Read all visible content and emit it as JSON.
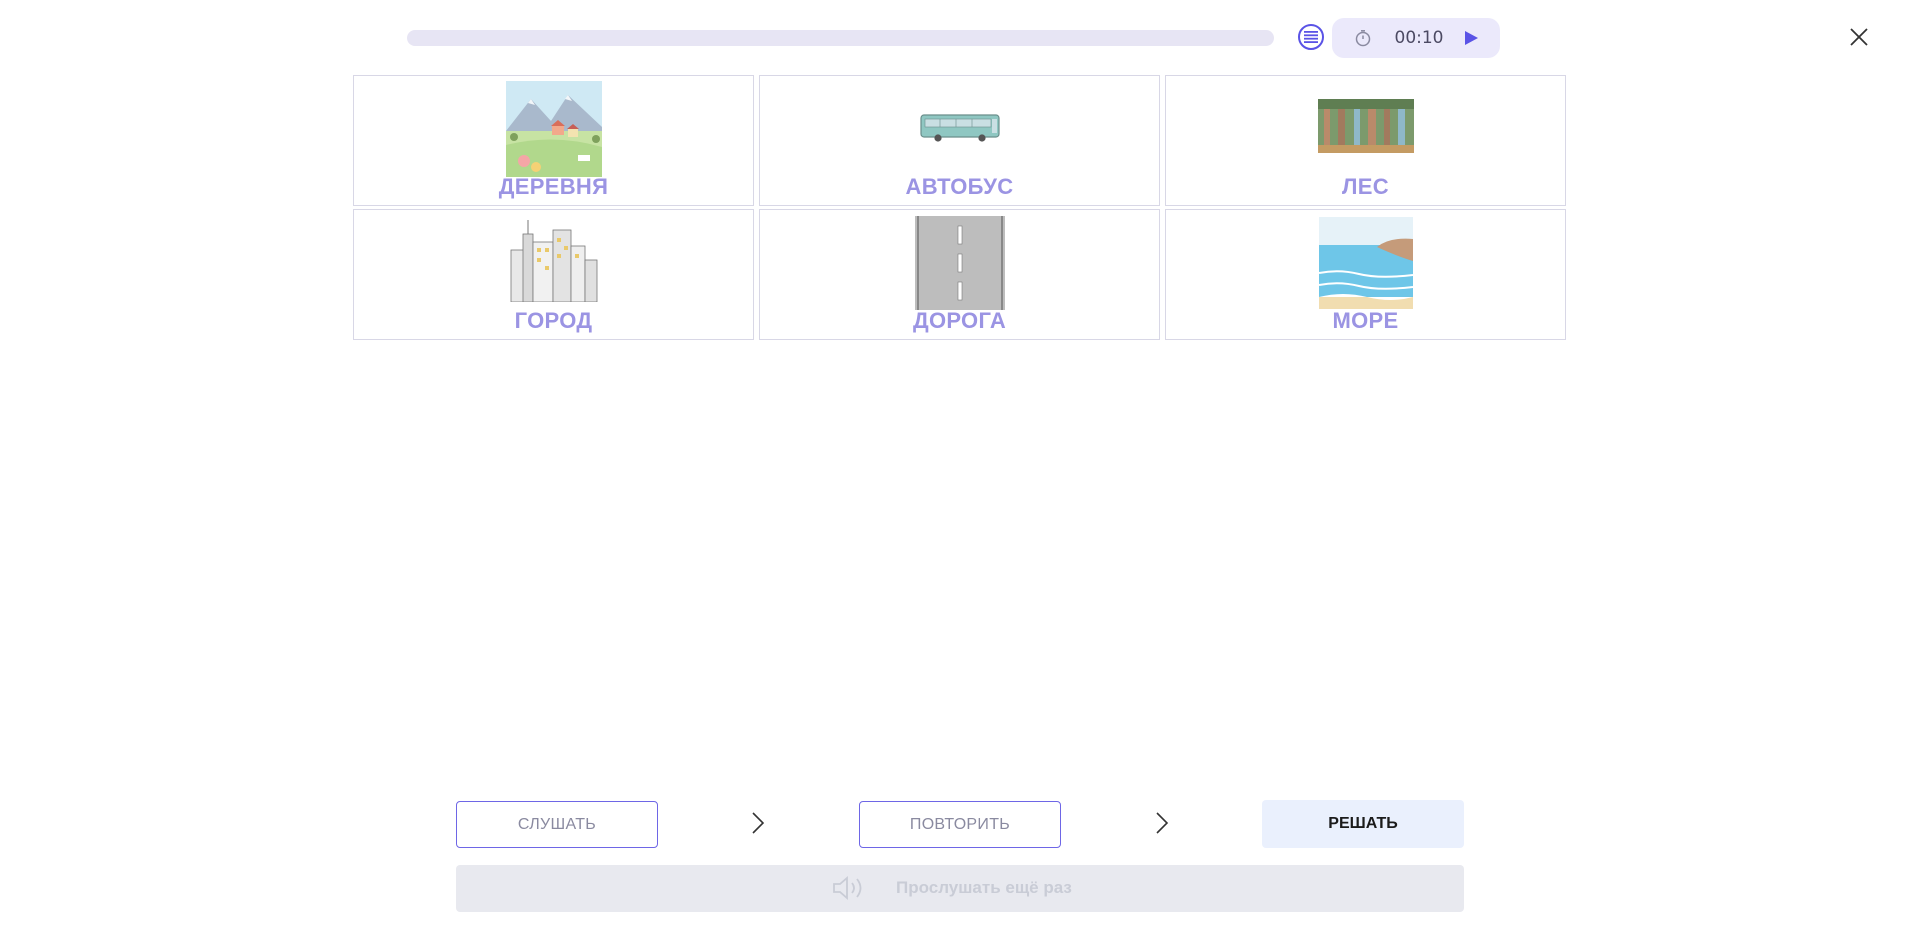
{
  "header": {
    "progress_fraction": 0.0,
    "timer": "00:10",
    "icons": {
      "list": "list-icon",
      "stopwatch": "stopwatch-icon",
      "play": "play-icon",
      "close": "close-icon"
    },
    "colors": {
      "accent": "#5a53e6",
      "track": "#e7e5f4",
      "pill": "#ebe9fb"
    }
  },
  "cards": [
    {
      "label": "ДЕРЕВНЯ",
      "image": "village-image"
    },
    {
      "label": "АВТОБУС",
      "image": "bus-image"
    },
    {
      "label": "ЛЕС",
      "image": "forest-image"
    },
    {
      "label": "ГОРОД",
      "image": "city-image"
    },
    {
      "label": "ДОРОГА",
      "image": "road-image"
    },
    {
      "label": "МОРЕ",
      "image": "sea-image"
    }
  ],
  "steps": {
    "listen": "СЛУШАТЬ",
    "repeat": "ПОВТОРИТЬ",
    "solve": "РЕШАТЬ"
  },
  "replay": {
    "label": "Прослушать ещё раз",
    "icon": "speaker-icon"
  },
  "colors": {
    "label": "#9b94e3",
    "solve_bg": "#eaf0fd",
    "replay_bg": "#e8e9ef"
  }
}
